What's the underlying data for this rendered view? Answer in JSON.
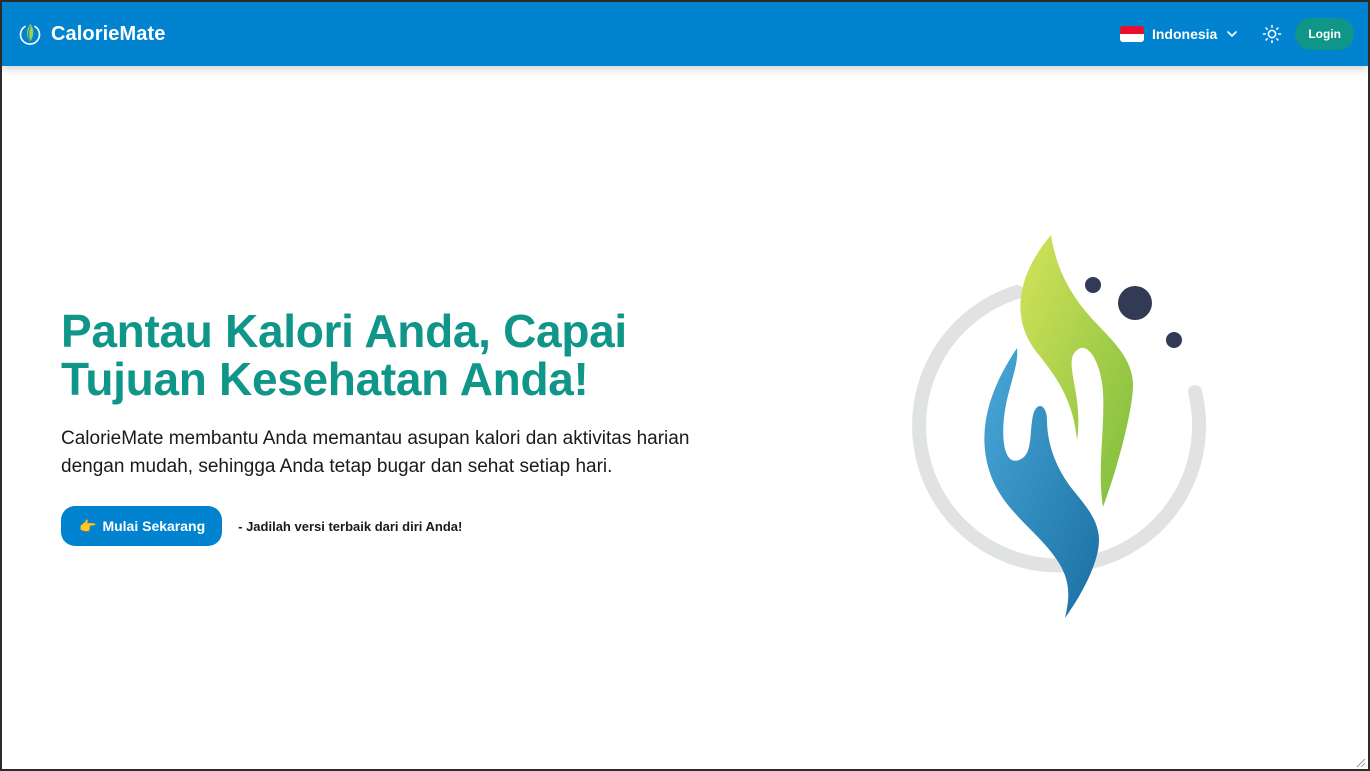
{
  "navbar": {
    "brand_name": "CalorieMate",
    "brand_icon": "leaf-drop-icon",
    "language": {
      "label": "Indonesia",
      "flag": "indonesia-flag-icon",
      "icon": "chevron-down-icon"
    },
    "theme_toggle_icon": "sun-icon",
    "login_label": "Login"
  },
  "hero": {
    "title_line1": "Pantau Kalori Anda, Capai",
    "title_line2": "Tujuan Kesehatan Anda!",
    "description_line1": "CalorieMate membantu Anda memantau asupan kalori dan aktivitas harian",
    "description_line2": "dengan mudah, sehingga Anda tetap bugar dan sehat setiap hari.",
    "cta_emoji": "👉",
    "cta_label": "Mulai Sekarang",
    "tagline": "- Jadilah versi terbaik dari diri Anda!"
  },
  "colors": {
    "navbar": "#0283d0",
    "primary_button": "#0283d0",
    "accent_teal": "#0f9688",
    "heading": "#0f9688",
    "logo_green": "#8cc63f",
    "logo_blue": "#2a86c0",
    "logo_dots": "#323a55"
  }
}
